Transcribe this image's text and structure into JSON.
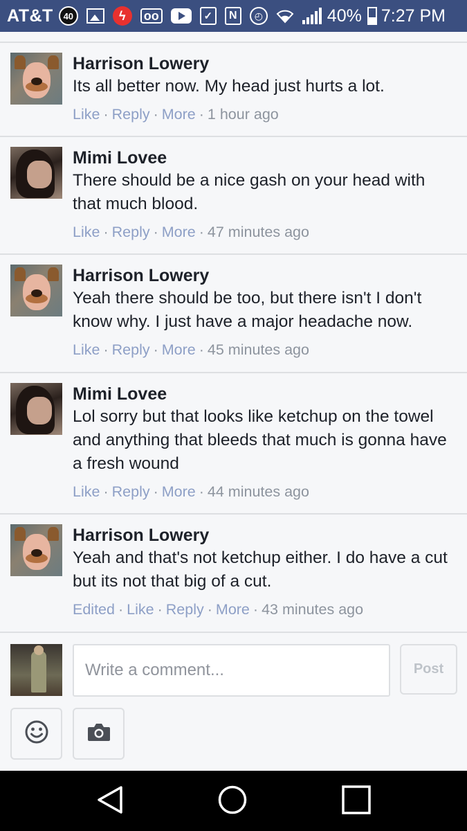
{
  "status_bar": {
    "carrier": "AT&T",
    "badge": "40",
    "nfc": "N",
    "voicemail": "oo",
    "battery_percent": "40%",
    "time": "7:27 PM",
    "icons": [
      "notification-badge-icon",
      "gallery-icon",
      "flash-icon",
      "voicemail-icon",
      "youtube-icon",
      "clipboard-check-icon",
      "nfc-icon",
      "alarm-icon",
      "wifi-icon",
      "signal-icon",
      "battery-icon"
    ]
  },
  "comments": [
    {
      "author": "Harrison Lowery",
      "avatar": "harrison",
      "text": "Its all better now. My head just hurts a lot.",
      "edited": "",
      "like": "Like",
      "reply": "Reply",
      "more": "More",
      "time": "1 hour ago"
    },
    {
      "author": "Mimi Lovee",
      "avatar": "mimi",
      "text": "There should be a nice gash on your head with that much blood.",
      "edited": "",
      "like": "Like",
      "reply": "Reply",
      "more": "More",
      "time": "47 minutes ago"
    },
    {
      "author": "Harrison Lowery",
      "avatar": "harrison",
      "text": "Yeah there should be too, but there isn't I don't know why. I just have a major headache now.",
      "edited": "",
      "like": "Like",
      "reply": "Reply",
      "more": "More",
      "time": "45 minutes ago"
    },
    {
      "author": "Mimi Lovee",
      "avatar": "mimi",
      "text": "Lol sorry but that looks like ketchup on the towel and anything that bleeds that much is gonna have a fresh wound",
      "edited": "",
      "like": "Like",
      "reply": "Reply",
      "more": "More",
      "time": "44 minutes ago"
    },
    {
      "author": "Harrison Lowery",
      "avatar": "harrison",
      "text": "Yeah and that's not ketchup either. I do have a cut but its not that big of a cut.",
      "edited": "Edited",
      "like": "Like",
      "reply": "Reply",
      "more": "More",
      "time": "43 minutes ago"
    }
  ],
  "composer": {
    "placeholder": "Write a comment...",
    "value": "",
    "post_label": "Post",
    "tools": [
      "emoji-icon",
      "camera-icon"
    ]
  },
  "navbar": {
    "buttons": [
      "back-icon",
      "home-icon",
      "recent-apps-icon"
    ]
  },
  "colors": {
    "status_bar": "#3b4f80",
    "background": "#f6f7f9",
    "action_link": "#8d9fc6",
    "meta_text": "#8d949e",
    "text": "#1d2129",
    "divider": "#dddfe2"
  }
}
